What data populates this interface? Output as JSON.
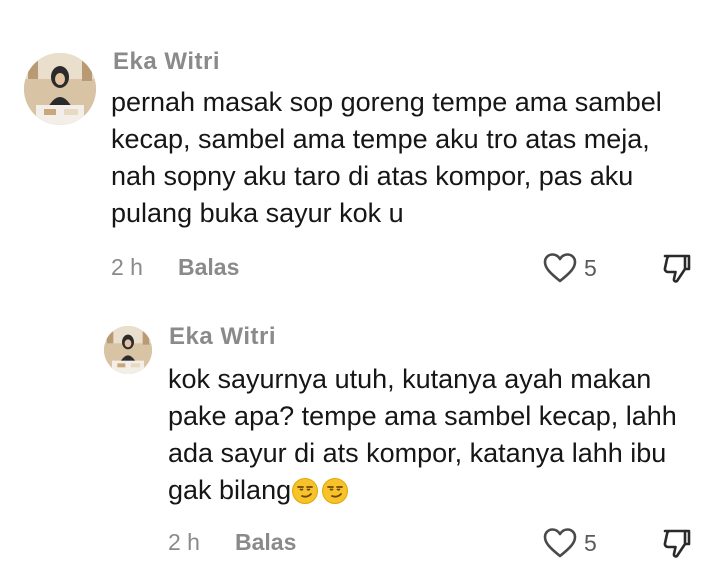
{
  "comments": [
    {
      "author": "Eka Witri",
      "lines": [
        "pernah masak sop goreng tempe ama sambel",
        "kecap, sambel ama tempe aku tro atas meja,",
        "nah sopny aku taro di atas kompor, pas aku",
        "pulang buka sayur kok u"
      ],
      "time": "2 h",
      "reply_label": "Balas",
      "likes": "5",
      "icons": {
        "like": "heart-outline-icon",
        "dislike": "thumbs-down-icon"
      }
    },
    {
      "author": "Eka Witri",
      "lines": [
        "kok sayurnya utuh, kutanya ayah makan",
        "pake apa? tempe ama sambel kecap, lahh",
        "ada sayur di ats kompor, katanya lahh ibu",
        "gak bilang"
      ],
      "emojis": [
        "smirk-face-emoji",
        "smirk-face-emoji"
      ],
      "time": "2 h",
      "reply_label": "Balas",
      "likes": "5",
      "icons": {
        "like": "heart-outline-icon",
        "dislike": "thumbs-down-icon"
      }
    }
  ],
  "colors": {
    "muted_text": "#8a8a8a",
    "body_text": "#161616",
    "emoji_yellow": "#f7c22b"
  }
}
